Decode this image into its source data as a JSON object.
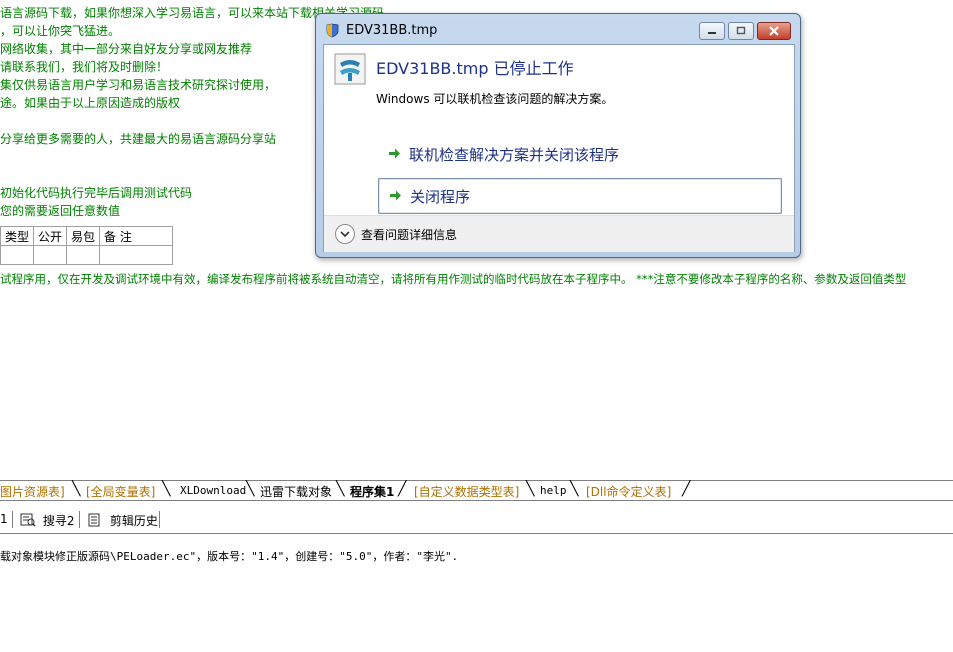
{
  "background_lines": [
    "语言源码下载，如果你想深入学习易语言，可以来本站下载相关学习源码",
    "，可以让你突飞猛进。",
    "网络收集，其中一部分来自好友分享或网友推荐",
    "请联系我们，我们将及时删除！",
    "集仅供易语言用户学习和易语言技术研究探讨使用，",
    "途。如果由于以上原因造成的版权",
    "分享给更多需要的人，共建最大的易语言源码分享站",
    "初始化代码执行完毕后调用测试代码",
    "您的需要返回任意数值"
  ],
  "table_headers": [
    "类型",
    "公开",
    "易包",
    "备 注"
  ],
  "notice_line": "试程序用，仅在开发及调试环境中有效，编译发布程序前将被系统自动清空，请将所有用作测试的临时代码放在本子程序中。 ***注意不要修改本子程序的名称、参数及返回值类型",
  "tabs": [
    {
      "label": "图片资源表]",
      "style": "orange"
    },
    {
      "label": "[全局变量表]",
      "style": "orange"
    },
    {
      "label": "XLDownload",
      "style": "code"
    },
    {
      "label": "迅雷下载对象",
      "style": "plain"
    },
    {
      "label": "程序集1",
      "style": "sel"
    },
    {
      "label": "[自定义数据类型表]",
      "style": "orange"
    },
    {
      "label": "help",
      "style": "code"
    },
    {
      "label": "[Dll命令定义表]",
      "style": "orange"
    }
  ],
  "lower_toolbar": {
    "item0": "1",
    "search2": "搜寻2",
    "clip_history": "剪辑历史"
  },
  "output_text": "载对象模块修正版源码\\PELoader.ec\"，版本号：\"1.4\"，创建号：\"5.0\"，作者：\"李光\".",
  "dialog": {
    "title": "EDV31BB.tmp",
    "heading": "EDV31BB.tmp 已停止工作",
    "message": "Windows 可以联机检查该问题的解决方案。",
    "option1": "联机检查解决方案并关闭该程序",
    "option2": "关闭程序",
    "details": "查看问题详细信息"
  },
  "colors": {
    "accent_text": "#1e3287",
    "green_text": "#008000",
    "arrow": "#2d9a2d"
  }
}
